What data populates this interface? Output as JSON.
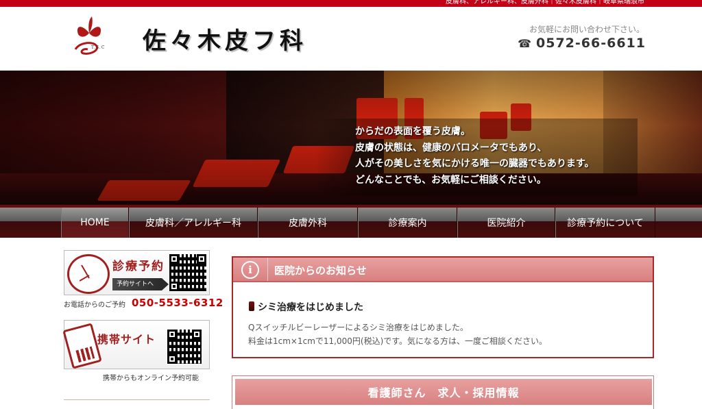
{
  "top_strip": {
    "text": "皮膚科、アレルギー科、皮膚外科｜佐々木皮膚科｜岐阜県瑞浪市"
  },
  "header": {
    "logo_small_text": "T.S.C",
    "site_title": "佐々木皮フ科",
    "contact_note": "お気軽にお問い合わせ下さい。",
    "phone_icon": "☎",
    "phone": "0572-66-6611"
  },
  "hero": {
    "lines": [
      "からだの表面を覆う皮膚。",
      "皮膚の状態は、健康のバロメータでもあり、",
      "人がその美しさを気にかける唯一の臓器でもあります。",
      "どんなことでも、お気軽にご相談ください。"
    ]
  },
  "nav": {
    "items": [
      {
        "label": "HOME",
        "active": true
      },
      {
        "label": "皮膚科／アレルギー科",
        "active": false
      },
      {
        "label": "皮膚外科",
        "active": false
      },
      {
        "label": "診療案内",
        "active": false
      },
      {
        "label": "医院紹介",
        "active": false
      },
      {
        "label": "診療予約について",
        "active": false
      }
    ]
  },
  "sidebar": {
    "reservation_banner": {
      "title": "診療予約",
      "button": "予約サイトへ",
      "qr_caption": "診療予約"
    },
    "reservation_phone_label": "お電話からのご予約",
    "reservation_phone": "050-5533-6312",
    "mobile_banner": {
      "title": "携帯サイト"
    },
    "mobile_note": "携帯からもオンライン予約可能"
  },
  "news": {
    "icon": "i",
    "title": "医院からのお知らせ",
    "item_title": "シミ治療をはじめました",
    "item_lines": [
      "Qスイッチルビーレーザーによるシミ治療をはじめました。",
      "料金は1cm×1cmで11,000円(税込)です。気になる方は、一度ご相談ください。"
    ]
  },
  "recruit": {
    "title": "看護師さん　求人・採用情報"
  },
  "colors": {
    "brand_red": "#c40018",
    "header_pink": "#d98080",
    "nav_dark": "#4a0c0c"
  }
}
